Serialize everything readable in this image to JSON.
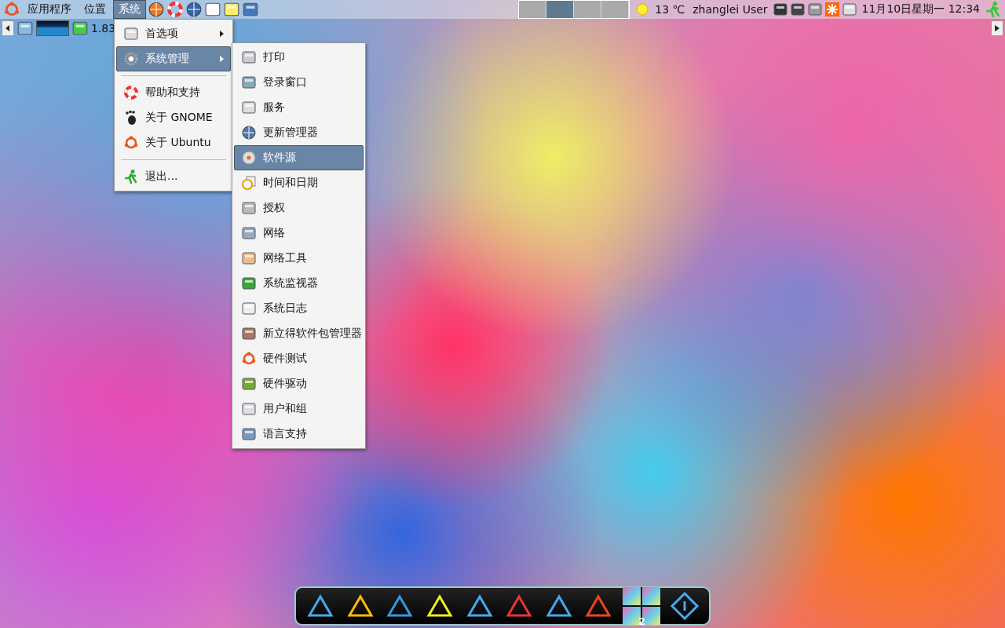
{
  "top_panel": {
    "menus": [
      {
        "label": "应用程序",
        "selected": false
      },
      {
        "label": "位置",
        "selected": false
      },
      {
        "label": "系统",
        "selected": true
      }
    ],
    "workspaces": [
      {
        "selected": false
      },
      {
        "selected": true
      },
      {
        "selected": false
      },
      {
        "selected": false
      }
    ],
    "weather": "13 ℃",
    "user": "zhanglei User",
    "clock": "11月10日星期一 12:34"
  },
  "second_panel": {
    "cpu_reading": "1.83"
  },
  "system_menu": [
    {
      "kind": "item",
      "label": "首选项",
      "submenu": true,
      "selected": false
    },
    {
      "kind": "item",
      "label": "系统管理",
      "submenu": true,
      "selected": true
    },
    {
      "kind": "separator"
    },
    {
      "kind": "item",
      "label": "帮助和支持",
      "submenu": false,
      "selected": false
    },
    {
      "kind": "item",
      "label": "关于 GNOME",
      "submenu": false,
      "selected": false
    },
    {
      "kind": "item",
      "label": "关于 Ubuntu",
      "submenu": false,
      "selected": false
    },
    {
      "kind": "separator"
    },
    {
      "kind": "item",
      "label": "退出...",
      "submenu": false,
      "selected": false
    }
  ],
  "admin_submenu": [
    {
      "label": "打印",
      "selected": false
    },
    {
      "label": "登录窗口",
      "selected": false
    },
    {
      "label": "服务",
      "selected": false
    },
    {
      "label": "更新管理器",
      "selected": false
    },
    {
      "label": "软件源",
      "selected": true
    },
    {
      "label": "时间和日期",
      "selected": false
    },
    {
      "label": "授权",
      "selected": false
    },
    {
      "label": "网络",
      "selected": false
    },
    {
      "label": "网络工具",
      "selected": false
    },
    {
      "label": "系统监视器",
      "selected": false
    },
    {
      "label": "系统日志",
      "selected": false
    },
    {
      "label": "新立得软件包管理器",
      "selected": false
    },
    {
      "label": "硬件测试",
      "selected": false
    },
    {
      "label": "硬件驱动",
      "selected": false
    },
    {
      "label": "用户和组",
      "selected": false
    },
    {
      "label": "语言支持",
      "selected": false
    }
  ],
  "dock": {
    "workspace_badge": "2"
  }
}
